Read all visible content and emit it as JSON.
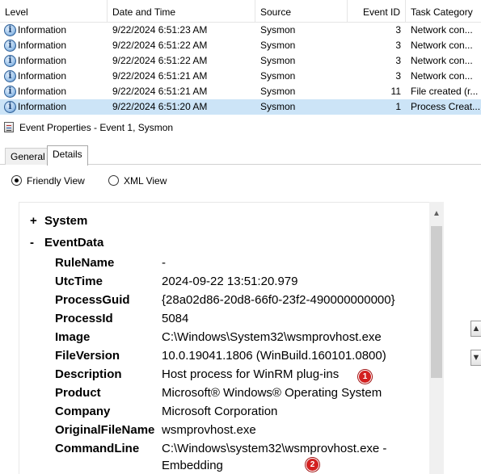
{
  "event_list": {
    "columns": [
      "Level",
      "Date and Time",
      "Source",
      "Event ID",
      "Task Category"
    ],
    "rows": [
      {
        "level": "Information",
        "datetime": "9/22/2024 6:51:23 AM",
        "source": "Sysmon",
        "event_id": "3",
        "task_category": "Network con..."
      },
      {
        "level": "Information",
        "datetime": "9/22/2024 6:51:22 AM",
        "source": "Sysmon",
        "event_id": "3",
        "task_category": "Network con..."
      },
      {
        "level": "Information",
        "datetime": "9/22/2024 6:51:22 AM",
        "source": "Sysmon",
        "event_id": "3",
        "task_category": "Network con..."
      },
      {
        "level": "Information",
        "datetime": "9/22/2024 6:51:21 AM",
        "source": "Sysmon",
        "event_id": "3",
        "task_category": "Network con..."
      },
      {
        "level": "Information",
        "datetime": "9/22/2024 6:51:21 AM",
        "source": "Sysmon",
        "event_id": "11",
        "task_category": "File created (r..."
      },
      {
        "level": "Information",
        "datetime": "9/22/2024 6:51:20 AM",
        "source": "Sysmon",
        "event_id": "1",
        "task_category": "Process Creat..."
      }
    ],
    "level_icon": "information-icon"
  },
  "properties": {
    "title": "Event Properties - Event 1, Sysmon",
    "tabs": [
      "General",
      "Details"
    ],
    "active_tab": "Details",
    "view_options": [
      {
        "label": "Friendly View",
        "checked": true
      },
      {
        "label": "XML View",
        "checked": false
      }
    ],
    "tree": {
      "system": {
        "toggle": "+",
        "label": "System"
      },
      "eventdata": {
        "toggle": "-",
        "label": "EventData"
      }
    },
    "fields": [
      {
        "name": "RuleName",
        "value": "-"
      },
      {
        "name": "UtcTime",
        "value": "2024-09-22 13:51:20.979"
      },
      {
        "name": "ProcessGuid",
        "value": "{28a02d86-20d8-66f0-23f2-490000000000}"
      },
      {
        "name": "ProcessId",
        "value": "5084"
      },
      {
        "name": "Image",
        "value": "C:\\Windows\\System32\\wsmprovhost.exe"
      },
      {
        "name": "FileVersion",
        "value": "10.0.19041.1806 (WinBuild.160101.0800)"
      },
      {
        "name": "Description",
        "value": "Host process for WinRM plug-ins"
      },
      {
        "name": "Product",
        "value": "Microsoft® Windows® Operating System"
      },
      {
        "name": "Company",
        "value": "Microsoft Corporation"
      },
      {
        "name": "OriginalFileName",
        "value": "wsmprovhost.exe"
      },
      {
        "name": "CommandLine",
        "value": "C:\\Windows\\system32\\wsmprovhost.exe -"
      },
      {
        "name": "",
        "value": "Embedding"
      }
    ],
    "annotations": [
      "1",
      "2"
    ]
  },
  "colors": {
    "selected_row": "#cce4f7",
    "badge": "#d32020"
  }
}
